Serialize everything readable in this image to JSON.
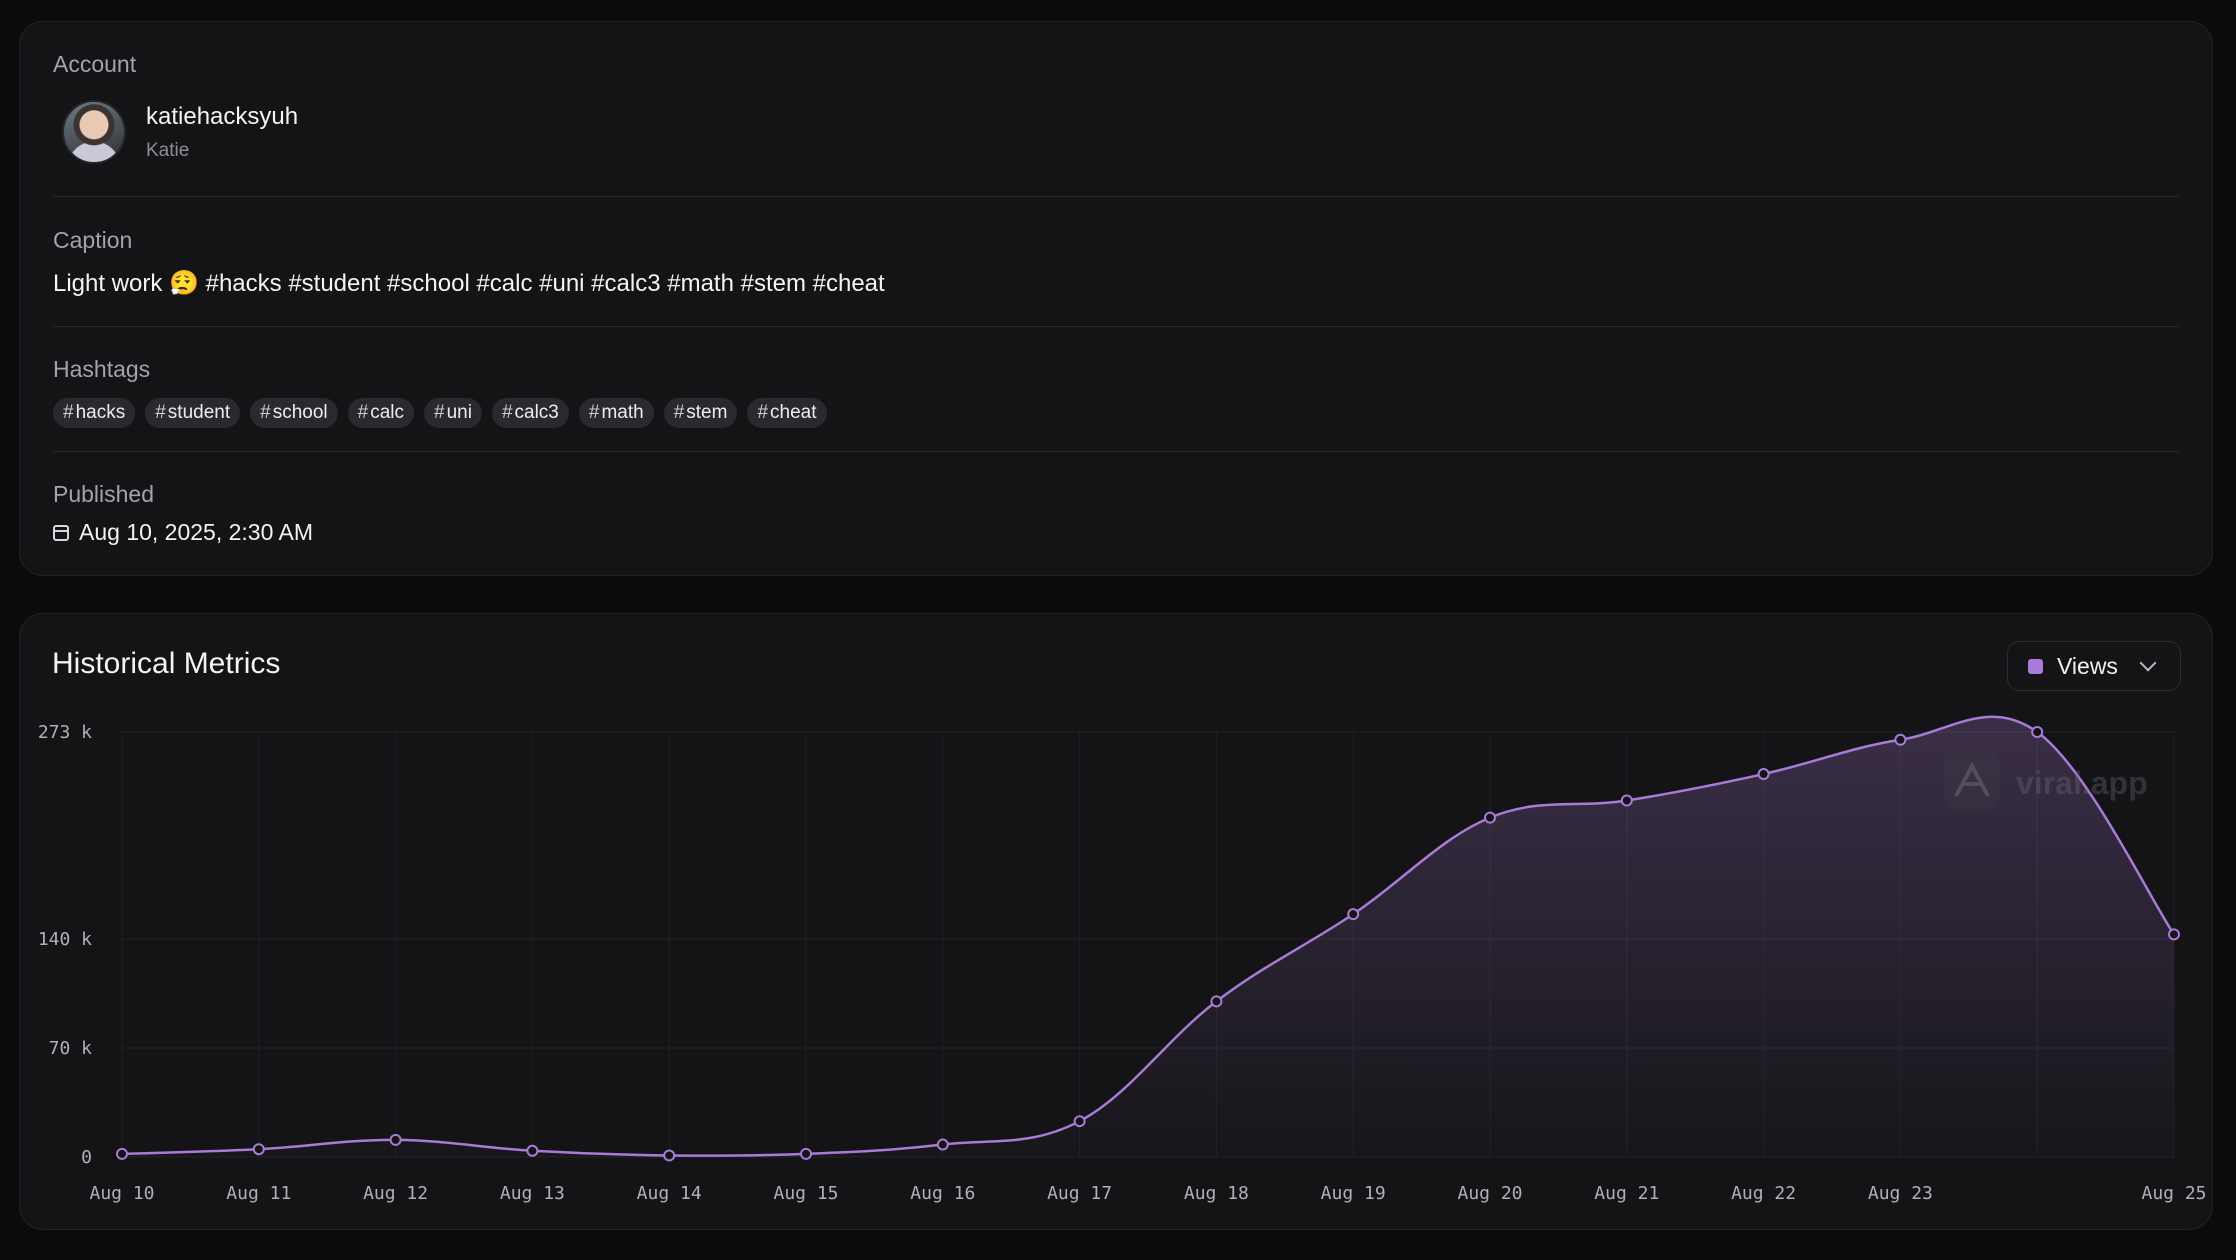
{
  "account": {
    "label": "Account",
    "username": "katiehacksyuh",
    "display_name": "Katie"
  },
  "caption": {
    "label": "Caption",
    "text": "Light work 😮‍💨 #hacks #student #school #calc #uni #calc3 #math #stem #cheat"
  },
  "hashtags": {
    "label": "Hashtags",
    "items": [
      "hacks",
      "student",
      "school",
      "calc",
      "uni",
      "calc3",
      "math",
      "stem",
      "cheat"
    ]
  },
  "published": {
    "label": "Published",
    "value": "Aug 10, 2025, 2:30 AM",
    "icon": "calendar-icon"
  },
  "metrics": {
    "title": "Historical Metrics",
    "metric_select": {
      "value": "Views",
      "color": "#a77bd6"
    },
    "watermark": "viral.app"
  },
  "chart_data": {
    "type": "area",
    "x": [
      "Aug 10",
      "Aug 11",
      "Aug 12",
      "Aug 13",
      "Aug 14",
      "Aug 15",
      "Aug 16",
      "Aug 17",
      "Aug 18",
      "Aug 19",
      "Aug 20",
      "Aug 21",
      "Aug 22",
      "Aug 23",
      "Aug 24",
      "Aug 25"
    ],
    "x_tick_labels": [
      "Aug 10",
      "Aug 11",
      "Aug 12",
      "Aug 13",
      "Aug 14",
      "Aug 15",
      "Aug 16",
      "Aug 17",
      "Aug 18",
      "Aug 19",
      "Aug 20",
      "Aug 21",
      "Aug 22",
      "Aug 23",
      "",
      "Aug 25"
    ],
    "series": [
      {
        "values": [
          2000,
          5000,
          11000,
          4000,
          1000,
          2000,
          8000,
          23000,
          100000,
          156000,
          218000,
          229000,
          246000,
          268000,
          273000,
          143000
        ],
        "color": "#a77bd6"
      }
    ],
    "y_ticks": [
      0,
      70000,
      140000,
      273000
    ],
    "y_tick_labels": [
      "0",
      "70 k",
      "140 k",
      "273 k"
    ],
    "ylim": [
      0,
      273000
    ],
    "grid": true,
    "legend": "none"
  }
}
